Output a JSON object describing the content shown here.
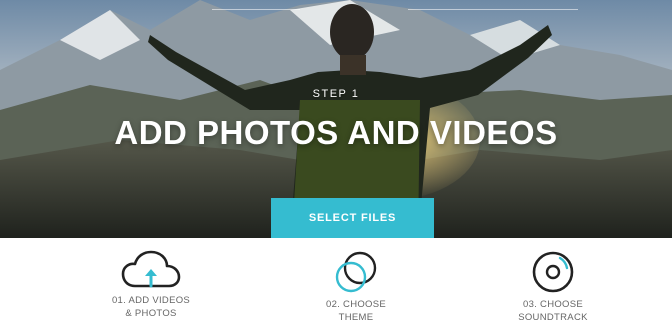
{
  "hero": {
    "step_label": "STEP 1",
    "title": "ADD PHOTOS AND VIDEOS",
    "button_label": "SELECT FILES"
  },
  "steps": [
    {
      "line1": "01. ADD VIDEOS",
      "line2": "& PHOTOS",
      "icon": "cloud-upload-icon"
    },
    {
      "line1": "02. CHOOSE",
      "line2": "THEME",
      "icon": "overlapping-circles-icon"
    },
    {
      "line1": "03. CHOOSE",
      "line2": "SOUNDTRACK",
      "icon": "disc-icon"
    }
  ],
  "colors": {
    "accent": "#35bcd0",
    "icon_dark": "#222222",
    "caption": "#666666"
  }
}
